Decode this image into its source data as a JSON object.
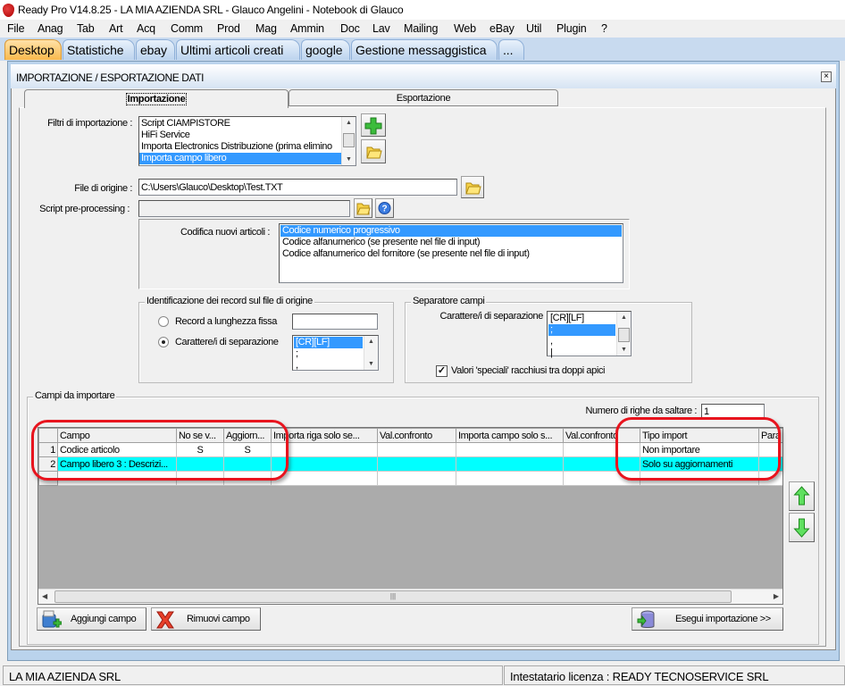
{
  "app": {
    "title": "Ready Pro V14.8.25 - LA MIA AZIENDA SRL - Glauco Angelini - Notebook di Glauco"
  },
  "menu": [
    "File",
    "Anag",
    "Tab",
    "Art",
    "Acq",
    "Comm",
    "Prod",
    "Mag",
    "Ammin",
    "Doc",
    "Lav",
    "Mailing",
    "Web",
    "eBay",
    "Util",
    "Plugin",
    "?"
  ],
  "app_tabs": [
    "Desktop",
    "Statistiche",
    "ebay",
    "Ultimi articoli creati",
    "google",
    "Gestione messaggistica",
    "..."
  ],
  "window": {
    "title": "IMPORTAZIONE / ESPORTAZIONE DATI",
    "tabs": [
      "Importazione",
      "Esportazione"
    ],
    "active_tab": "Importazione"
  },
  "form": {
    "filtri_label": "Filtri di importazione :",
    "filtri": [
      "Script CIAMPISTORE",
      "HiFi Service",
      "Importa Electronics Distribuzione (prima elimino",
      "Importa campo libero"
    ],
    "filtri_selected": "Importa campo libero",
    "file_label": "File di origine :",
    "file_value": "C:\\Users\\Glauco\\Desktop\\Test.TXT",
    "script_label": "Script pre-processing :",
    "script_value": "",
    "codifica_label": "Codifica nuovi articoli :",
    "codifica": [
      "Codice numerico progressivo",
      "Codice alfanumerico (se presente nel file di input)",
      "Codice alfanumerico del fornitore (se presente nel file di input)"
    ],
    "ident_legend": "Identificazione dei record sul file di origine",
    "radio_fissa": "Record a lunghezza fissa",
    "radio_sep": "Carattere/i di separazione",
    "radio_selected": "Carattere/i di separazione",
    "ident_list": [
      "[CR][LF]",
      ";",
      ","
    ],
    "sep_legend": "Separatore campi",
    "sep_label": "Carattere/i di separazione",
    "sep_list": [
      "[CR][LF]",
      ";",
      ",",
      "|"
    ],
    "sep_selected": ";",
    "checkbox_label": "Valori 'speciali' racchiusi tra doppi apici",
    "checkbox_checked": true
  },
  "campi": {
    "legend": "Campi da importare",
    "righe_label": "Numero di righe da saltare :",
    "righe_value": "1",
    "columns": [
      "Campo",
      "No se v...",
      "Aggiorn...",
      "Importa riga solo se...",
      "Val.confronto",
      "Importa campo solo s...",
      "Val.confronto",
      "Tipo import",
      "Para"
    ],
    "rows": [
      [
        "1",
        "Codice articolo",
        "S",
        "S",
        "",
        "",
        "",
        "",
        "Non importare",
        ""
      ],
      [
        "2",
        "Campo libero 3 : Descrizi...",
        "",
        "",
        "",
        "",
        "",
        "",
        "Solo su aggiornamenti",
        ""
      ]
    ],
    "highlight_color": "#00ffff"
  },
  "buttons": {
    "aggiungi": "Aggiungi campo",
    "rimuovi": "Rimuovi campo",
    "esegui": "Esegui importazione >>"
  },
  "status": {
    "left": "LA MIA AZIENDA SRL",
    "right": "Intestatario licenza : READY TECNOSERVICE SRL"
  }
}
